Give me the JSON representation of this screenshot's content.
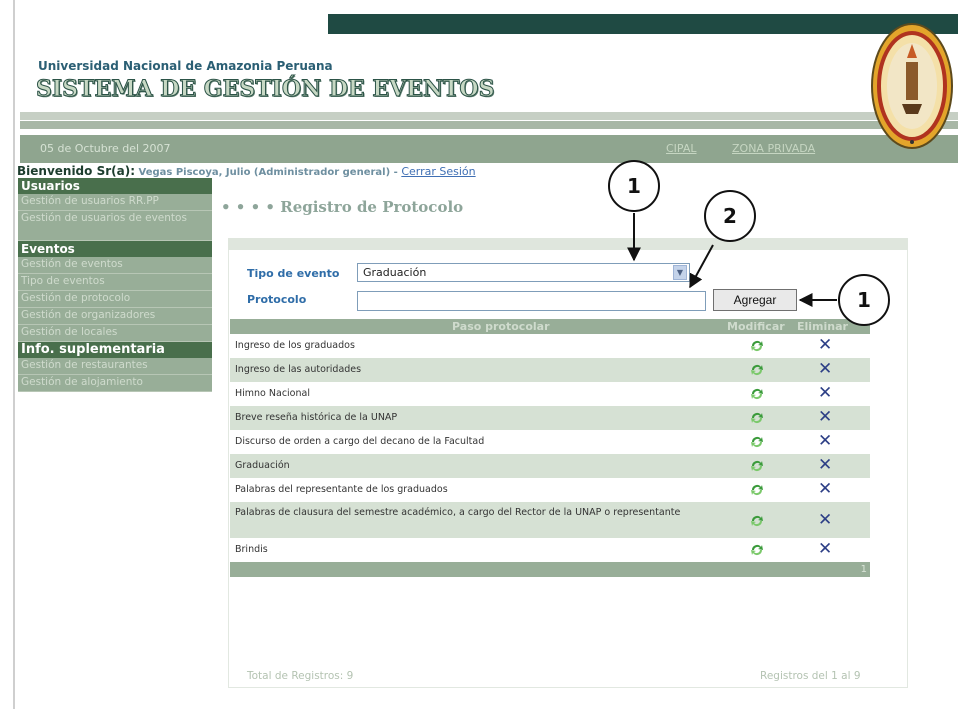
{
  "header": {
    "university": "Universidad Nacional de Amazonia Peruana",
    "system": "SISTEMA DE GESTIÓN DE EVENTOS",
    "date": "05 de Octubre del 2007",
    "nav_principal": "CIPAL",
    "nav_privada": "ZONA PRIVADA"
  },
  "welcome": {
    "label": "Bienvenido Sr(a):",
    "user": "Vegas Piscoya, Julio (Administrador general)",
    "separator": "-",
    "logout": "Cerrar Sesión"
  },
  "sidebar": {
    "sections": [
      {
        "title": "Usuarios",
        "items": [
          "Gestión de usuarios RR.PP",
          "Gestión de usuarios de eventos"
        ]
      },
      {
        "title": "Eventos",
        "items": [
          "Gestión de eventos",
          "Tipo de eventos",
          "Gestión de protocolo",
          "Gestión de organizadores",
          "Gestión de locales"
        ]
      },
      {
        "title": "Info. suplementaria",
        "items": [
          "Gestión de restaurantes",
          "Gestión de alojamiento"
        ]
      }
    ]
  },
  "page": {
    "title": "• • • • Registro de Protocolo"
  },
  "form": {
    "tipo_label": "Tipo de evento",
    "tipo_value": "Graduación",
    "protocolo_label": "Protocolo",
    "protocolo_value": "",
    "add_button": "Agregar"
  },
  "table": {
    "headers": [
      "Paso protocolar",
      "Modificar",
      "Eliminar"
    ],
    "rows": [
      "Ingreso de los graduados",
      "Ingreso de las autoridades",
      "Himno Nacional",
      "Breve reseña histórica de la UNAP",
      "Discurso de orden a cargo del decano de la Facultad",
      "Graduación",
      "Palabras del representante de los graduados",
      "Palabras de clausura del semestre académico, a cargo del Rector de la UNAP o representante",
      "Brindis"
    ],
    "footer_page": "1",
    "total": "Total de Registros: 9",
    "range": "Registros del 1 al 9"
  },
  "callouts": {
    "c1_top": "1",
    "c2": "2",
    "c1_right": "1"
  },
  "icons": {
    "modify": "refresh-arrows-icon",
    "delete": "x-delete-icon",
    "logo": "university-seal-icon"
  },
  "colors": {
    "sidebar_header": "#496f4c",
    "sidebar_item": "#98ae98",
    "row_alt": "#d6e1d4",
    "label_blue": "#2f6da8"
  }
}
